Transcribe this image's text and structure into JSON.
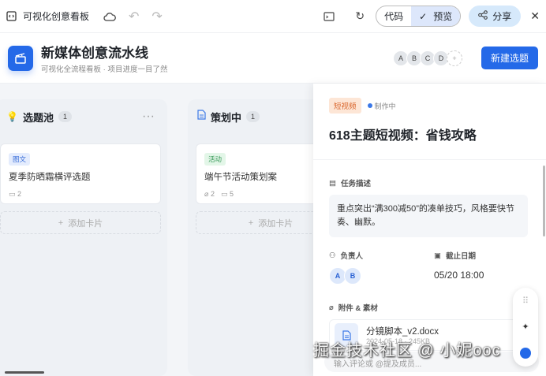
{
  "topbar": {
    "title": "可视化创意看板",
    "code_label": "代码",
    "preview_label": "预览",
    "share_label": "分享"
  },
  "header": {
    "title": "新媒体创意流水线",
    "subtitle": "可视化全流程看板 · 项目进度一目了然",
    "members": [
      "A",
      "B",
      "C",
      "D"
    ],
    "add_member": "+",
    "new_button": "新建选题"
  },
  "columns": [
    {
      "title": "选题池",
      "count": "1",
      "more": "···",
      "card": {
        "tag": "图文",
        "title": "夏季防晒霜横评选题",
        "comments": "2"
      },
      "add_label": "添加卡片"
    },
    {
      "title": "策划中",
      "count": "1",
      "card": {
        "tag": "活动",
        "title": "端午节活动策划案",
        "attachments": "2",
        "comments": "5"
      },
      "add_label": "添加卡片"
    }
  ],
  "detail": {
    "tag": "短视频",
    "status": "制作中",
    "title": "618主题短视频：省钱攻略",
    "desc_label": "任务描述",
    "desc": "重点突出“满300减50”的凑单技巧，风格要快节奏、幽默。",
    "owner_label": "负责人",
    "owners": [
      "A",
      "B"
    ],
    "due_label": "截止日期",
    "due": "05/20 18:00",
    "attach_label": "附件 & 素材",
    "file": {
      "name": "分镜脚本_v2.docx",
      "meta": "2024-05-18 · 245KB"
    },
    "comment_placeholder": "输入评论或 @提及成员..."
  },
  "watermark": "掘金技术社区 @ 小妮ooc"
}
